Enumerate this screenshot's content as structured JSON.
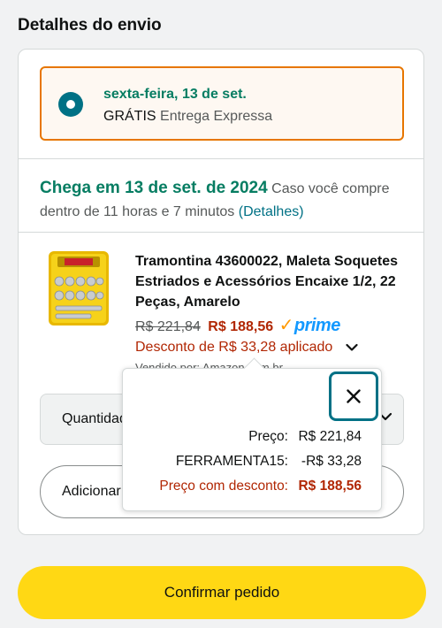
{
  "section": {
    "title": "Detalhes do envio"
  },
  "shipping_option": {
    "date": "sexta-feira, 13 de set.",
    "free_label": "GRÁTIS",
    "type": "Entrega Expressa"
  },
  "arrival": {
    "headline": "Chega em 13 de set. de 2024",
    "text": " Caso você compre dentro de 11 horas e 7 minutos ",
    "details_link": "(Detalhes)"
  },
  "product": {
    "title": "Tramontina 43600022, Maleta Soquetes Estriados e Acessórios Encaixe 1/2, 22 Peças, Amarelo",
    "old_price": "R$ 221,84",
    "new_price": "R$ 188,56",
    "prime_label": "prime",
    "discount_text": "Desconto de R$ 33,28 aplicado",
    "seller_text": "Vendido por: Amazon.com.br"
  },
  "quantity": {
    "label": "Quantidade"
  },
  "add_button": {
    "label": "Adicionar"
  },
  "discount_popover": {
    "rows": [
      {
        "label": "Preço:",
        "value": "R$ 221,84"
      },
      {
        "label": "FERRAMENTA15:",
        "value": "-R$ 33,28"
      },
      {
        "label": "Preço com desconto:",
        "value": "R$ 188,56"
      }
    ]
  },
  "confirm_button": {
    "label": "Confirmar pedido"
  },
  "colors": {
    "accent_teal": "#007185",
    "green": "#067d62",
    "price_red": "#b12704",
    "selected_border": "#e77600",
    "confirm_yellow": "#ffd814",
    "prime_blue": "#1399ff"
  }
}
